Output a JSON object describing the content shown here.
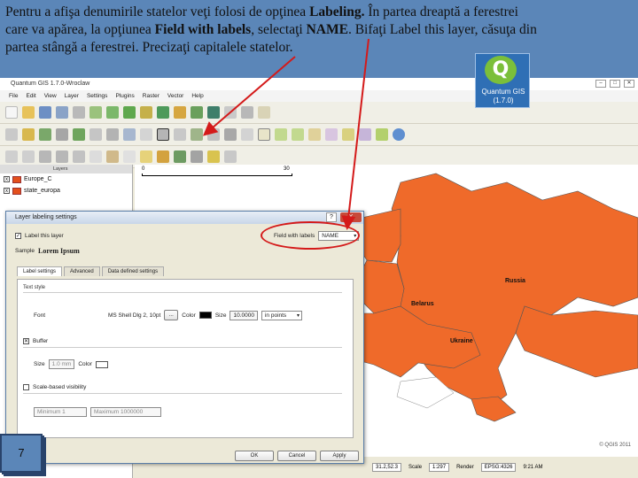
{
  "slide": {
    "line1_a": "Pentru a afişa denumirile statelor  veţi folosi de opţinea ",
    "line1_bold": "Labeling.",
    "line1_b": "  În partea dreaptă a ferestrei",
    "line2_a": "care  va apărea, la opţiunea ",
    "line2_bold1": "Field with labels",
    "line2_b": ", selectaţi ",
    "line2_bold2": "NAME",
    "line2_c": ".  Bifaţi Label this layer, căsuţa din",
    "line3": "partea stângă a ferestrei.  Precizaţi capitalele statelor.",
    "slide_number": "7"
  },
  "app_icon": {
    "label_line1": "Quantum GIS",
    "label_line2": "(1.7.0)",
    "glyph": "Q"
  },
  "window": {
    "title": "Quantum GIS 1.7.0-Wroclaw",
    "menu": [
      "File",
      "Edit",
      "View",
      "Layer",
      "Settings",
      "Plugins",
      "Raster",
      "Vector",
      "Help"
    ]
  },
  "layers_panel": {
    "header": "Layers",
    "items": [
      {
        "name": "Europe_C",
        "checked": "x"
      },
      {
        "name": "state_europa",
        "checked": "x"
      }
    ]
  },
  "map": {
    "scale_start": "0",
    "scale_end": "30",
    "labels": {
      "russia": "Russia",
      "belarus": "Belarus",
      "ukraine": "Ukraine"
    },
    "copyright": "© QGIS 2011",
    "fill_color": "#ef6a2a"
  },
  "statusbar": {
    "coordinate": "31.2,52.3",
    "scale_label": "Scale",
    "scale_value": "1:297",
    "render_label": "Render",
    "epsg": "EPSG:4326",
    "clock": "9:21 AM"
  },
  "dialog": {
    "title": "Layer labeling settings",
    "help": "?",
    "close": "X",
    "label_this_layer": "Label this layer",
    "field_with_labels": "Field with labels",
    "field_value": "NAME",
    "sample_label": "Sample",
    "sample_text": "Lorem Ipsum",
    "tabs": [
      "Label settings",
      "Advanced",
      "Data defined settings"
    ],
    "text_style": "Text style",
    "font_label": "Font",
    "font_value": "MS Shell Dlg 2, 10pt",
    "font_btn": "...",
    "color_label": "Color",
    "size_label": "Size",
    "size_value": "10.0000",
    "size_unit": "in points",
    "buffer_label": "Buffer",
    "buffer_size_label": "Size",
    "buffer_size_value": "1.0 mm",
    "buffer_color_label": "Color",
    "scale_visibility": "Scale-based visibility",
    "min_value": "Minimum 1",
    "max_value": "Maximum 1000000",
    "ok": "OK",
    "cancel": "Cancel",
    "apply": "Apply"
  }
}
